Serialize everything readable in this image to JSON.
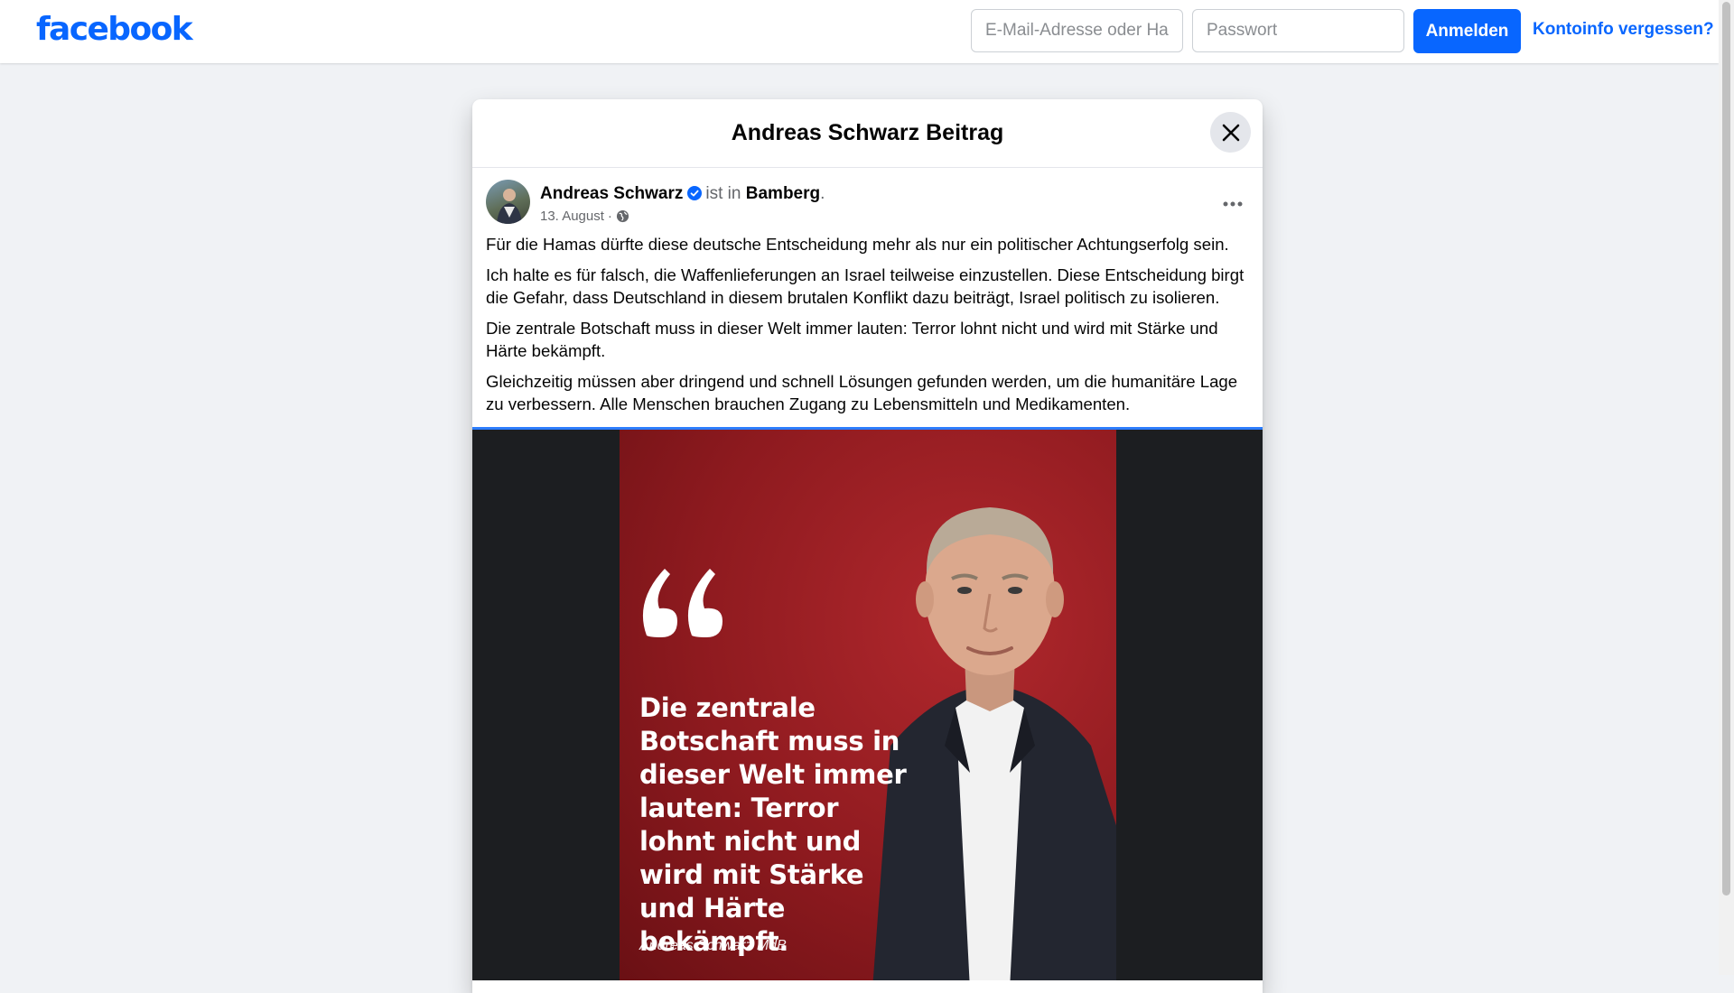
{
  "topbar": {
    "logo": "facebook",
    "email_placeholder": "E-Mail-Adresse oder Handynummer",
    "password_placeholder": "Passwort",
    "login_label": "Anmelden",
    "forgot_label": "Kontoinfo vergessen?"
  },
  "modal": {
    "title": "Andreas Schwarz Beitrag"
  },
  "post": {
    "author": "Andreas Schwarz",
    "location_prefix": "ist in",
    "location": "Bamberg",
    "location_suffix": ".",
    "date": "13. August",
    "date_separator": "·",
    "paragraphs": [
      "Für die Hamas dürfte diese deutsche Entscheidung mehr als nur ein politischer Achtungserfolg sein.",
      "Ich halte es für falsch, die Waffenlieferungen an Israel teilweise einzustellen. Diese Entscheidung birgt die Gefahr, dass Deutschland in diesem brutalen Konflikt dazu beiträgt, Israel politisch zu isolieren.",
      "Die zentrale Botschaft muss in dieser Welt immer lauten: Terror lohnt nicht und wird mit Stärke und Härte bekämpft.",
      "Gleichzeitig müssen aber dringend und schnell Lösungen gefunden werden, um die humanitäre Lage zu verbessern. Alle Menschen brauchen Zugang zu Lebensmitteln und Medikamenten."
    ],
    "image": {
      "quote": "Die zentrale Botschaft muss in dieser Welt immer lauten: Terror lohnt nicht und wird mit Stärke und Härte bekämpft.",
      "credit": "Andreas Schwarz MdB"
    }
  },
  "colors": {
    "brand": "#0866ff",
    "page_background": "#f0f2f5",
    "image_red": "#9e1e23"
  },
  "icons": [
    "close-icon",
    "verified-icon",
    "globe-icon",
    "more-icon",
    "quote-icon"
  ]
}
